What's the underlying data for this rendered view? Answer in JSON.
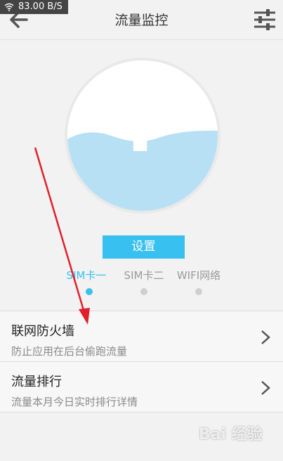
{
  "status": {
    "speed": "83.00 B/S"
  },
  "header": {
    "title": "流量监控"
  },
  "gauge": {
    "symbol": "?"
  },
  "set_button": {
    "label": "设置"
  },
  "sim_tabs": [
    {
      "label": "SIM卡一",
      "active": true
    },
    {
      "label": "SIM卡二",
      "active": false
    },
    {
      "label": "WIFI网络",
      "active": false
    }
  ],
  "menu": [
    {
      "title": "联网防火墙",
      "subtitle": "防止应用在后台偷跑流量"
    },
    {
      "title": "流量排行",
      "subtitle": "流量本月今日实时排行详情"
    }
  ],
  "watermark": {
    "text": "Bai 经验"
  },
  "colors": {
    "accent": "#38c0f0",
    "water": "#b8e0f5",
    "annotation_arrow": "#e0202a"
  }
}
